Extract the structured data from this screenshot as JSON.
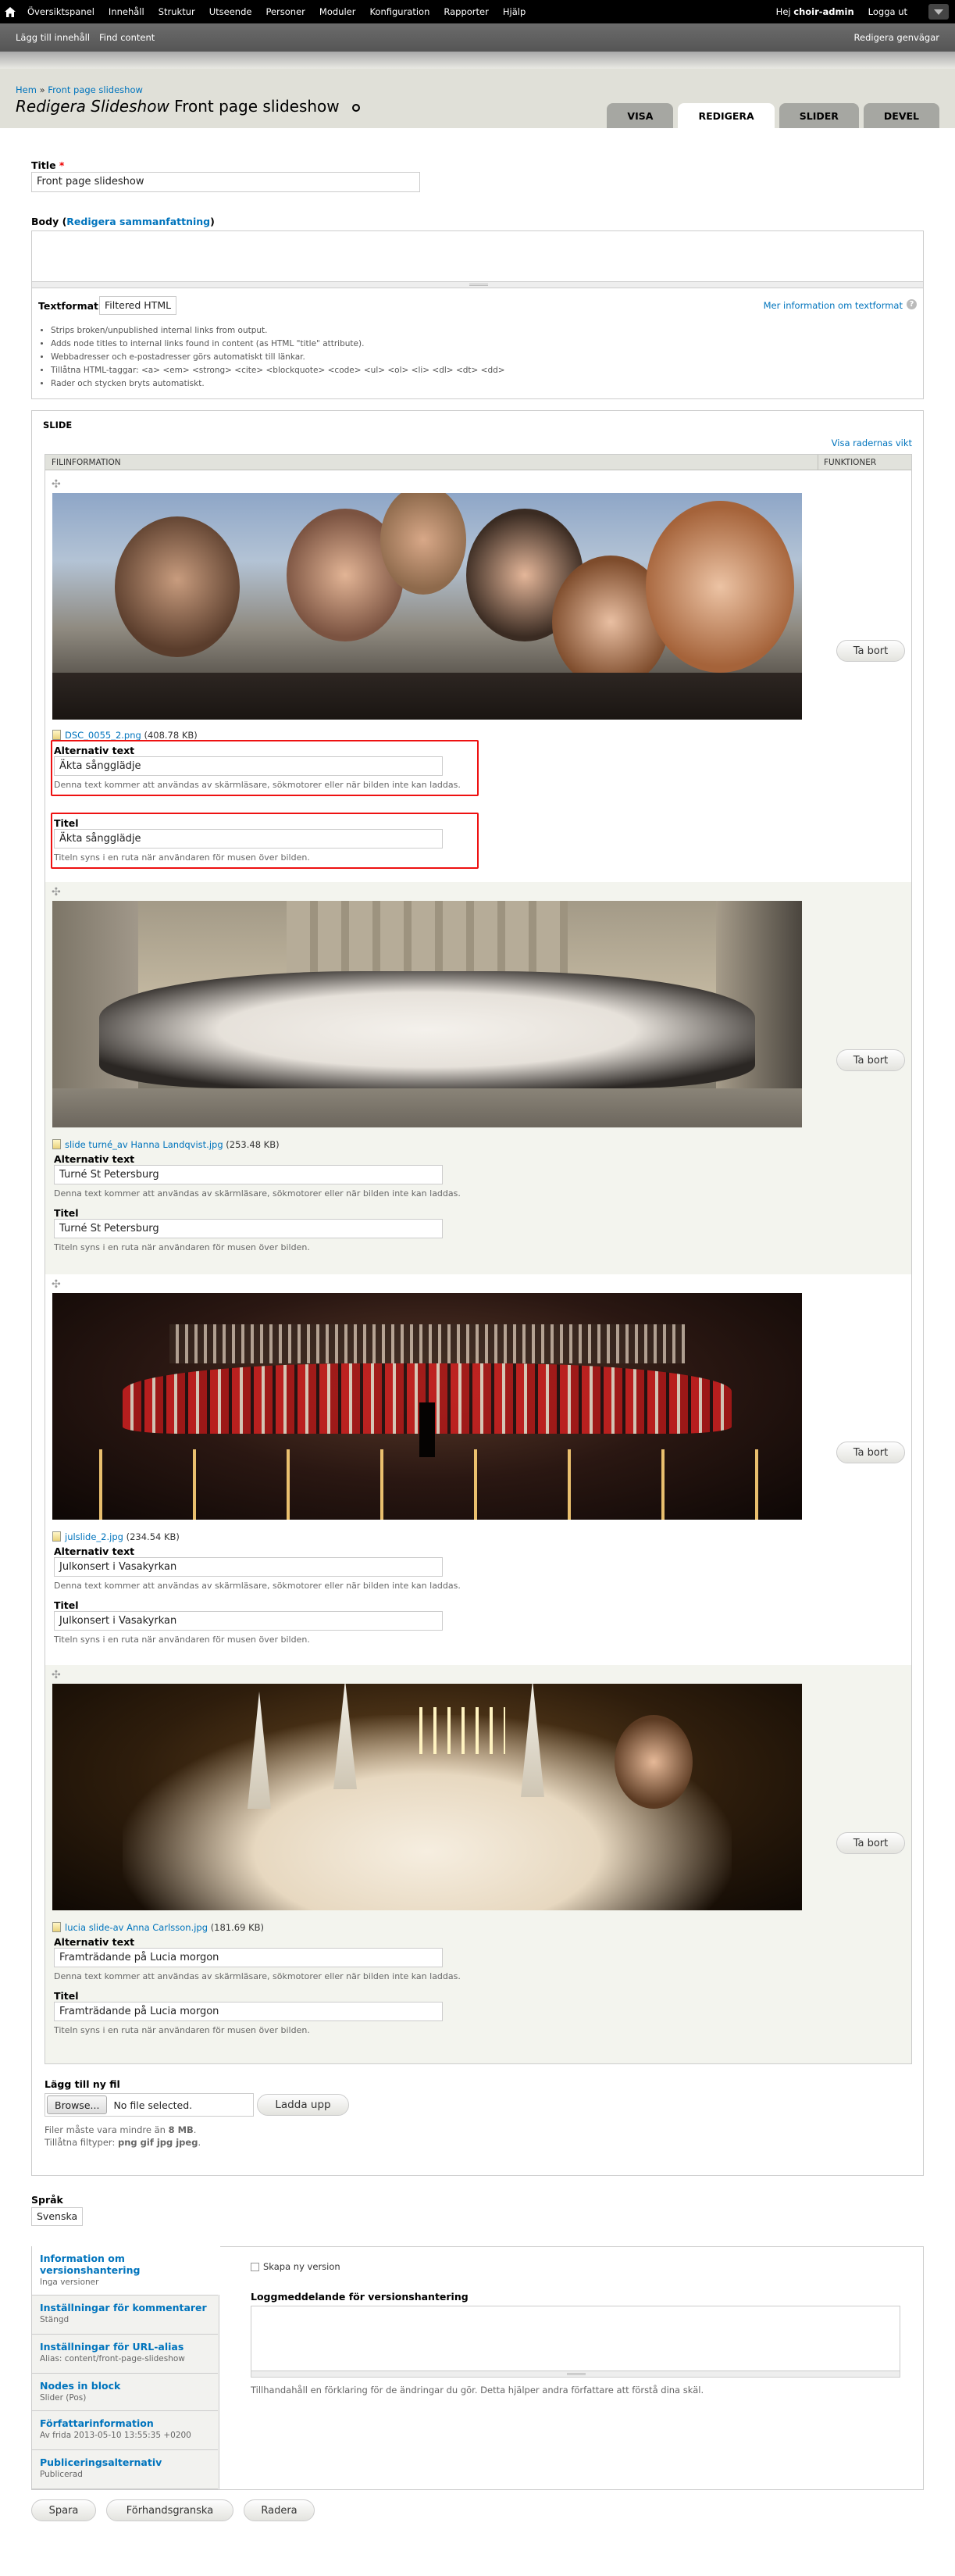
{
  "toolbar": {
    "items": [
      "Översiktspanel",
      "Innehåll",
      "Struktur",
      "Utseende",
      "Personer",
      "Moduler",
      "Konfiguration",
      "Rapporter",
      "Hjälp"
    ],
    "greeting": "Hej",
    "username": "choir-admin",
    "logout": "Logga ut"
  },
  "shortcuts": {
    "add_content": "Lägg till innehåll",
    "find_content": "Find content",
    "edit_shortcuts": "Redigera genvägar"
  },
  "breadcrumb": {
    "home": "Hem",
    "sep": "»",
    "current": "Front page slideshow"
  },
  "page_title": {
    "prefix": "Redigera",
    "type": "Slideshow",
    "name": "Front page slideshow"
  },
  "tabs": [
    "Visa",
    "Redigera",
    "Slider",
    "Devel"
  ],
  "title_field": {
    "label": "Title",
    "required": "*",
    "value": "Front page slideshow"
  },
  "body_field": {
    "label": "Body",
    "summary_link": "Redigera sammanfattning"
  },
  "text_format": {
    "label": "Textformat",
    "selected": "Filtered HTML",
    "more_info": "Mer information om textformat",
    "tips": [
      "Strips broken/unpublished internal links from output.",
      "Adds node titles to internal links found in content (as HTML \"title\" attribute).",
      "Webbadresser och e-postadresser görs automatiskt till länkar.",
      "Tillåtna HTML-taggar: <a> <em> <strong> <cite> <blockquote> <code> <ul> <ol> <li> <dl> <dt> <dd>",
      "Rader och stycken bryts automatiskt."
    ]
  },
  "slide": {
    "legend": "Slide",
    "show_weights": "Visa radernas vikt",
    "col_file": "FILINFORMATION",
    "col_ops": "FUNKTIONER",
    "alt_label": "Alternativ text",
    "alt_desc": "Denna text kommer att användas av skärmläsare, sökmotorer eller när bilden inte kan laddas.",
    "title_label": "Titel",
    "title_desc": "Titeln syns i en ruta när användaren för musen över bilden.",
    "remove": "Ta bort",
    "rows": [
      {
        "file": "DSC_0055_2.png",
        "size": "(408.78 KB)",
        "alt": "Äkta sångglädje",
        "title": "Äkta sångglädje"
      },
      {
        "file": "slide turné_av Hanna Landqvist.jpg",
        "size": "(253.48 KB)",
        "alt": "Turné St Petersburg",
        "title": "Turné St Petersburg"
      },
      {
        "file": "julslide_2.jpg",
        "size": "(234.54 KB)",
        "alt": "Julkonsert i Vasakyrkan",
        "title": "Julkonsert i Vasakyrkan"
      },
      {
        "file": "lucia slide-av Anna Carlsson.jpg",
        "size": "(181.69 KB)",
        "alt": "Framträdande på Lucia morgon",
        "title": "Framträdande på Lucia morgon"
      }
    ],
    "add_label": "Lägg till ny fil",
    "browse": "Browse...",
    "no_file": "No file selected.",
    "upload": "Ladda upp",
    "size_note_prefix": "Filer måste vara mindre än",
    "size_note_value": "8 MB",
    "types_prefix": "Tillåtna filtyper:",
    "types_value": "png gif jpg jpeg"
  },
  "language": {
    "label": "Språk",
    "value": "Svenska"
  },
  "vertical_tabs": [
    {
      "title": "Information om versionshantering",
      "summary": "Inga versioner"
    },
    {
      "title": "Inställningar för kommentarer",
      "summary": "Stängd"
    },
    {
      "title": "Inställningar för URL-alias",
      "summary": "Alias: content/front-page-slideshow"
    },
    {
      "title": "Nodes in block",
      "summary": "Slider (Pos)"
    },
    {
      "title": "Författarinformation",
      "summary": "Av frida 2013-05-10 13:55:35 +0200"
    },
    {
      "title": "Publiceringsalternativ",
      "summary": "Publicerad"
    }
  ],
  "revision": {
    "checkbox": "Skapa ny version",
    "log_label": "Loggmeddelande för versionshantering",
    "log_desc": "Tillhandahåll en förklaring för de ändringar du gör. Detta hjälper andra författare att förstå dina skäl."
  },
  "actions": {
    "save": "Spara",
    "preview": "Förhandsgranska",
    "delete": "Radera"
  }
}
